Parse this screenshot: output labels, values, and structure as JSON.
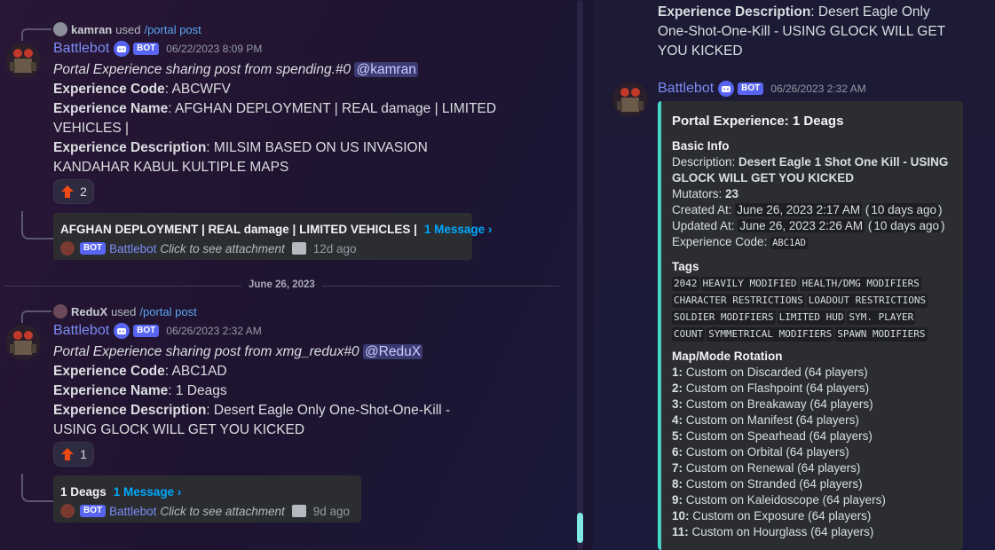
{
  "messages": [
    {
      "reply_user": "kamran",
      "reply_used": "used",
      "reply_command": "/portal post",
      "author": "Battlebot",
      "bot_badge": "BOT",
      "timestamp": "06/22/2023 8:09 PM",
      "intro": "Portal Experience sharing post from spending.#0",
      "mention": "@kamran",
      "code_label": "Experience Code",
      "code_value": ": ABCWFV",
      "name_label": "Experience Name",
      "name_value": ": AFGHAN DEPLOYMENT | REAL damage | LIMITED VEHICLES |",
      "desc_label": "Experience Description",
      "desc_value": ": MILSIM BASED ON US INVASION KANDAHAR KABUL KULTIPLE MAPS",
      "reaction_count": "2",
      "thread_title": "AFGHAN DEPLOYMENT | REAL damage | LIMITED VEHICLES |",
      "thread_link": "1 Message ›",
      "thread_bot_badge": "BOT",
      "thread_author": "Battlebot",
      "thread_click": "Click to see attachment",
      "thread_ago": "12d ago"
    },
    {
      "reply_user": "ReduX",
      "reply_used": "used",
      "reply_command": "/portal post",
      "author": "Battlebot",
      "bot_badge": "BOT",
      "timestamp": "06/26/2023 2:32 AM",
      "intro": "Portal Experience sharing post from xmg_redux#0",
      "mention": "@ReduX",
      "code_label": "Experience Code",
      "code_value": ": ABC1AD",
      "name_label": "Experience Name",
      "name_value": ": 1 Deags",
      "desc_label": "Experience Description",
      "desc_value": ": Desert Eagle Only One-Shot-One-Kill - USING GLOCK WILL GET YOU KICKED",
      "reaction_count": "1",
      "thread_title": "1 Deags",
      "thread_link": "1 Message ›",
      "thread_bot_badge": "BOT",
      "thread_author": "Battlebot",
      "thread_click": "Click to see attachment",
      "thread_ago": "9d ago"
    }
  ],
  "date_separator": "June 26, 2023",
  "thread_panel": {
    "top_desc_label": "Experience Description",
    "top_desc_value": ": Desert Eagle Only One-Shot-One-Kill - USING GLOCK WILL GET YOU KICKED",
    "author": "Battlebot",
    "bot_badge": "BOT",
    "timestamp": "06/26/2023 2:32 AM",
    "embed": {
      "title": "Portal Experience: 1 Deags",
      "basic_info_label": "Basic Info",
      "description_label": "Description: ",
      "description_value": "Desert Eagle 1 Shot One Kill - USING GLOCK WILL GET YOU KICKED",
      "mutators_label": "Mutators: ",
      "mutators_value": "23",
      "created_label": "Created At: ",
      "created_value": "June 26, 2023 2:17 AM",
      "created_rel": "10 days ago",
      "updated_label": "Updated At: ",
      "updated_value": "June 26, 2023 2:26 AM",
      "updated_rel": "10 days ago",
      "code_label": "Experience Code: ",
      "code_value": "ABC1AD",
      "tags_label": "Tags",
      "tags": [
        "2042",
        "HEAVILY MODIFIED",
        "HEALTH/DMG MODIFIERS",
        "CHARACTER RESTRICTIONS",
        "LOADOUT RESTRICTIONS",
        "SOLDIER MODIFIERS",
        "LIMITED HUD",
        "SYM. PLAYER",
        "COUNT",
        "SYMMETRICAL MODIFIERS",
        "SPAWN MODIFIERS"
      ],
      "rotation_label": "Map/Mode Rotation",
      "rotation": [
        {
          "n": "1:",
          "text": "Custom on Discarded (64 players)"
        },
        {
          "n": "2:",
          "text": "Custom on Flashpoint (64 players)"
        },
        {
          "n": "3:",
          "text": "Custom on Breakaway (64 players)"
        },
        {
          "n": "4:",
          "text": "Custom on Manifest (64 players)"
        },
        {
          "n": "5:",
          "text": "Custom on Spearhead (64 players)"
        },
        {
          "n": "6:",
          "text": "Custom on Orbital (64 players)"
        },
        {
          "n": "7:",
          "text": "Custom on Renewal (64 players)"
        },
        {
          "n": "8:",
          "text": "Custom on Stranded (64 players)"
        },
        {
          "n": "9:",
          "text": "Custom on Kaleidoscope (64 players)"
        },
        {
          "n": "10:",
          "text": "Custom on Exposure (64 players)"
        },
        {
          "n": "11:",
          "text": "Custom on Hourglass (64 players)"
        }
      ]
    }
  },
  "colors": {
    "accent": "#5865f2",
    "embed_bar": "#45d4c6",
    "link": "#00a8fc",
    "username": "#7b8cf5",
    "reaction_arrow": "#f04a14"
  },
  "icons": {
    "upvote": "red-up-arrow",
    "bot": "discord-bot-icon",
    "image": "image-icon"
  }
}
